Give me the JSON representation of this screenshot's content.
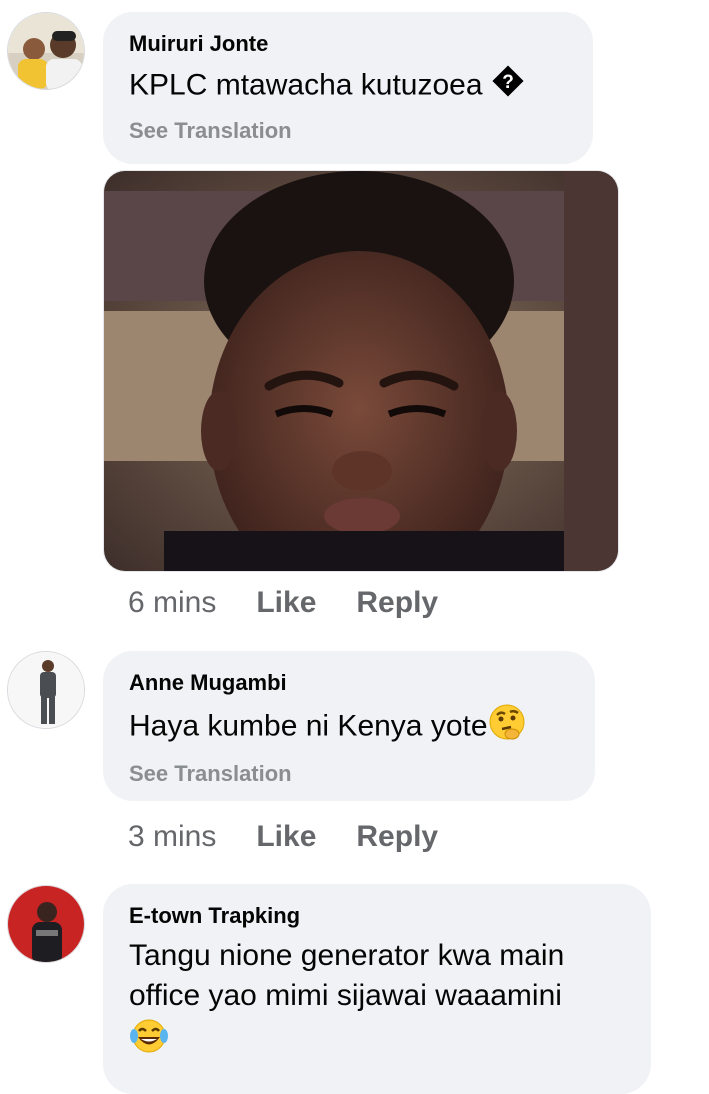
{
  "comments": [
    {
      "author": "Muiruri Jonte",
      "text": "KPLC mtawacha kutuzoea",
      "emoji_icon": "question-diamond-icon",
      "see_translation": "See Translation",
      "time": "6 mins",
      "like": "Like",
      "reply": "Reply"
    },
    {
      "author": "Anne Mugambi",
      "text": "Haya kumbe ni Kenya yote",
      "emoji_icon": "thinking-face-icon",
      "see_translation": "See Translation",
      "time": "3 mins",
      "like": "Like",
      "reply": "Reply"
    },
    {
      "author": "E-town Trapking",
      "text_line1": "Tangu nione generator kwa main",
      "text_line2": "office yao mimi sijawai waaamini",
      "emoji_icon": "tears-of-joy-icon"
    }
  ]
}
